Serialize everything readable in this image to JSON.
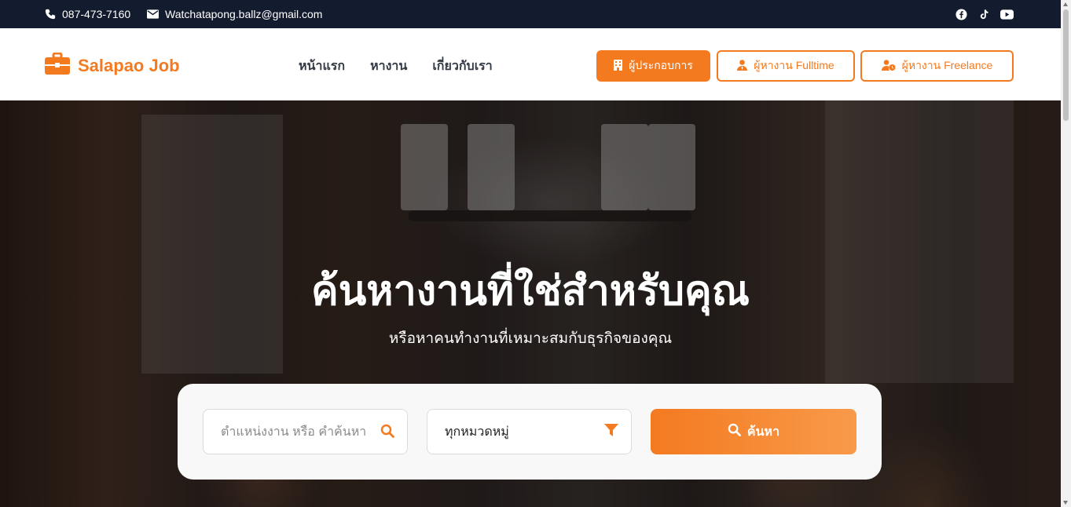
{
  "topbar": {
    "phone": "087-473-7160",
    "email": "Watchatapong.ballz@gmail.com",
    "phone_icon": "phone-icon",
    "email_icon": "envelope-icon",
    "socials": [
      "facebook-icon",
      "tiktok-icon",
      "youtube-icon"
    ]
  },
  "header": {
    "brand": "Salapao Job",
    "nav": [
      "หน้าแรก",
      "หางาน",
      "เกี่ยวกับเรา"
    ],
    "buttons": {
      "employer": "ผู้ประกอบการ",
      "fulltime": "ผู้หางาน Fulltime",
      "freelance": "ผู้หางาน Freelance"
    }
  },
  "hero": {
    "title": "ค้นหางานที่ใช่สำหรับคุณ",
    "subtitle": "หรือหาคนทำงานที่เหมาะสมกับธุรกิจของคุณ"
  },
  "search": {
    "placeholder": "ตำแหน่งงาน หรือ คำค้นหา",
    "category": "ทุกหมวดหมู่",
    "button": "ค้นหา"
  },
  "colors": {
    "accent": "#f47a20",
    "topbar": "#131b2e"
  }
}
